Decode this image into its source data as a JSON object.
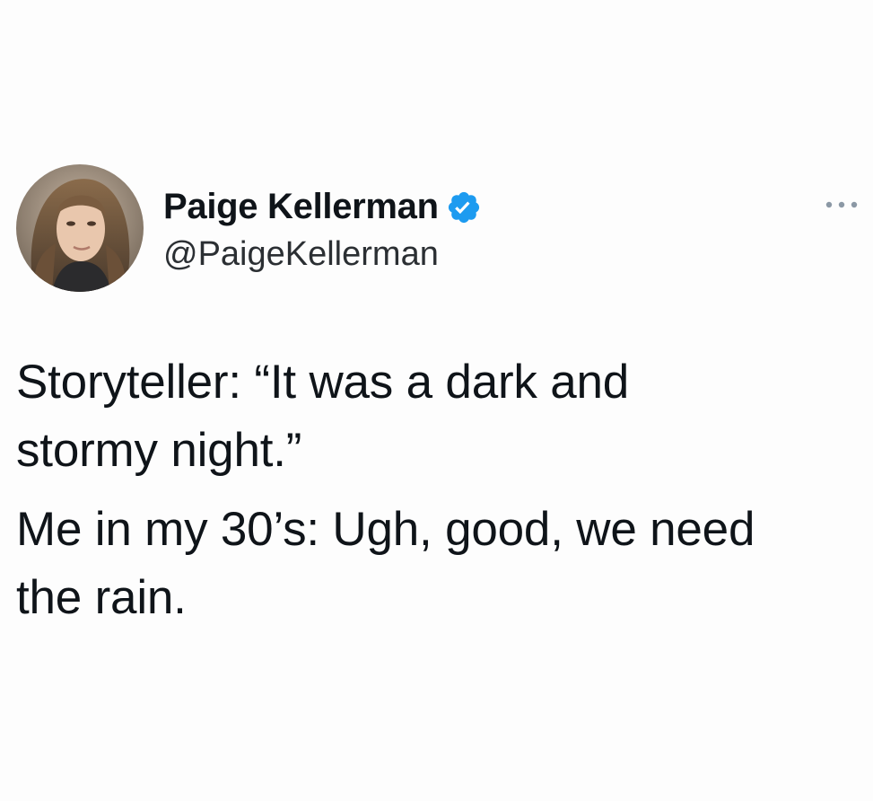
{
  "author": {
    "display_name": "Paige Kellerman",
    "handle": "@PaigeKellerman",
    "verified": true,
    "avatar_icon": "profile-photo",
    "verified_icon": "verified-badge-icon"
  },
  "menu": {
    "icon": "more-horizontal-icon"
  },
  "tweet": {
    "paragraphs": [
      "Storyteller: “It was a dark and\nstormy night.”",
      "Me in my 30’s: Ugh, good, we need\nthe rain."
    ]
  },
  "colors": {
    "verified_badge": "#1d9bf0",
    "text_primary": "#0f1419",
    "text_secondary": "#2b2f33",
    "menu_dots": "#8b98a5",
    "background": "#fdfdfd"
  }
}
